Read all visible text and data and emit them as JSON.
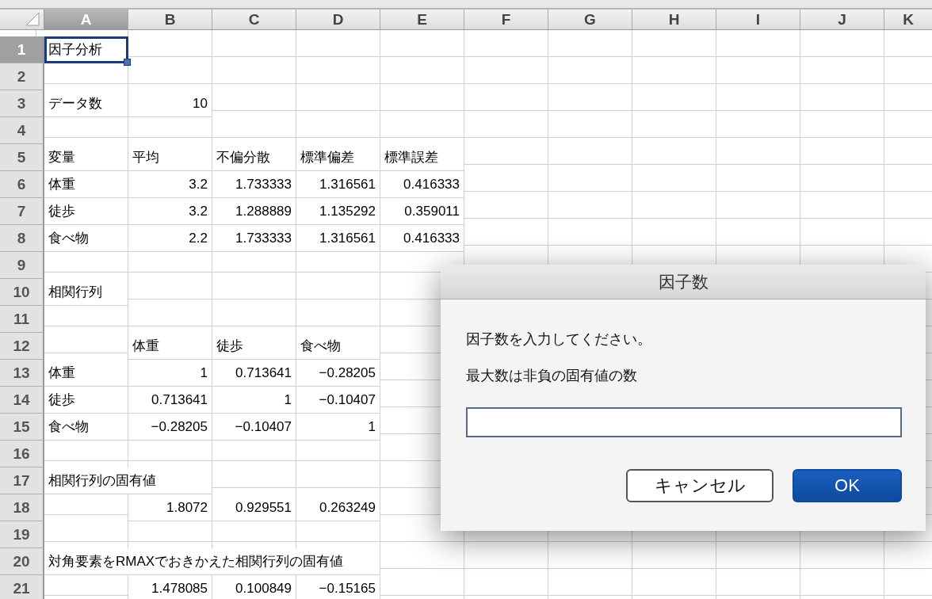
{
  "columns": [
    {
      "label": "A",
      "selected": true
    },
    {
      "label": "B",
      "selected": false
    },
    {
      "label": "C",
      "selected": false
    },
    {
      "label": "D",
      "selected": false
    },
    {
      "label": "E",
      "selected": false
    },
    {
      "label": "F",
      "selected": false
    },
    {
      "label": "G",
      "selected": false
    },
    {
      "label": "H",
      "selected": false
    },
    {
      "label": "I",
      "selected": false
    },
    {
      "label": "J",
      "selected": false
    },
    {
      "label": "K",
      "selected": false
    }
  ],
  "rows": [
    {
      "header": "1",
      "selected": true,
      "cells": [
        {
          "text": "因子分析",
          "kind": "text",
          "selected": true
        }
      ]
    },
    {
      "header": "2",
      "selected": false,
      "cells": []
    },
    {
      "header": "3",
      "selected": false,
      "cells": [
        {
          "text": "データ数",
          "kind": "text",
          "selected": false
        },
        {
          "text": "10",
          "kind": "number",
          "selected": false
        }
      ]
    },
    {
      "header": "4",
      "selected": false,
      "cells": []
    },
    {
      "header": "5",
      "selected": false,
      "cells": [
        {
          "text": "変量",
          "kind": "text",
          "selected": false
        },
        {
          "text": "平均",
          "kind": "text",
          "selected": false
        },
        {
          "text": "不偏分散",
          "kind": "text",
          "selected": false
        },
        {
          "text": "標準偏差",
          "kind": "text",
          "selected": false
        },
        {
          "text": "標準誤差",
          "kind": "text",
          "selected": false
        }
      ]
    },
    {
      "header": "6",
      "selected": false,
      "cells": [
        {
          "text": "体重",
          "kind": "text",
          "selected": false
        },
        {
          "text": "3.2",
          "kind": "number",
          "selected": false
        },
        {
          "text": "1.733333",
          "kind": "number",
          "selected": false
        },
        {
          "text": "1.316561",
          "kind": "number",
          "selected": false
        },
        {
          "text": "0.416333",
          "kind": "number",
          "selected": false
        }
      ]
    },
    {
      "header": "7",
      "selected": false,
      "cells": [
        {
          "text": "徒歩",
          "kind": "text",
          "selected": false
        },
        {
          "text": "3.2",
          "kind": "number",
          "selected": false
        },
        {
          "text": "1.288889",
          "kind": "number",
          "selected": false
        },
        {
          "text": "1.135292",
          "kind": "number",
          "selected": false
        },
        {
          "text": "0.359011",
          "kind": "number",
          "selected": false
        }
      ]
    },
    {
      "header": "8",
      "selected": false,
      "cells": [
        {
          "text": "食べ物",
          "kind": "text",
          "selected": false
        },
        {
          "text": "2.2",
          "kind": "number",
          "selected": false
        },
        {
          "text": "1.733333",
          "kind": "number",
          "selected": false
        },
        {
          "text": "1.316561",
          "kind": "number",
          "selected": false
        },
        {
          "text": "0.416333",
          "kind": "number",
          "selected": false
        }
      ]
    },
    {
      "header": "9",
      "selected": false,
      "cells": []
    },
    {
      "header": "10",
      "selected": false,
      "cells": [
        {
          "text": "相関行列",
          "kind": "text",
          "selected": false
        }
      ]
    },
    {
      "header": "11",
      "selected": false,
      "cells": []
    },
    {
      "header": "12",
      "selected": false,
      "cells": [
        null,
        {
          "text": "体重",
          "kind": "text",
          "selected": false
        },
        {
          "text": "徒歩",
          "kind": "text",
          "selected": false
        },
        {
          "text": "食べ物",
          "kind": "text",
          "selected": false
        }
      ]
    },
    {
      "header": "13",
      "selected": false,
      "cells": [
        {
          "text": "体重",
          "kind": "text",
          "selected": false
        },
        {
          "text": "1",
          "kind": "number",
          "selected": false
        },
        {
          "text": "0.713641",
          "kind": "number",
          "selected": false
        },
        {
          "text": "−0.28205",
          "kind": "number",
          "selected": false
        }
      ]
    },
    {
      "header": "14",
      "selected": false,
      "cells": [
        {
          "text": "徒歩",
          "kind": "text",
          "selected": false
        },
        {
          "text": "0.713641",
          "kind": "number",
          "selected": false
        },
        {
          "text": "1",
          "kind": "number",
          "selected": false
        },
        {
          "text": "−0.10407",
          "kind": "number",
          "selected": false
        }
      ]
    },
    {
      "header": "15",
      "selected": false,
      "cells": [
        {
          "text": "食べ物",
          "kind": "text",
          "selected": false
        },
        {
          "text": "−0.28205",
          "kind": "number",
          "selected": false
        },
        {
          "text": "−0.10407",
          "kind": "number",
          "selected": false
        },
        {
          "text": "1",
          "kind": "number",
          "selected": false
        }
      ]
    },
    {
      "header": "16",
      "selected": false,
      "cells": []
    },
    {
      "header": "17",
      "selected": false,
      "cells": [
        {
          "text": "相関行列の固有値",
          "kind": "text",
          "selected": false
        }
      ]
    },
    {
      "header": "18",
      "selected": false,
      "cells": [
        null,
        {
          "text": "1.8072",
          "kind": "number",
          "selected": false
        },
        {
          "text": "0.929551",
          "kind": "number",
          "selected": false
        },
        {
          "text": "0.263249",
          "kind": "number",
          "selected": false
        }
      ]
    },
    {
      "header": "19",
      "selected": false,
      "cells": []
    },
    {
      "header": "20",
      "selected": false,
      "cells": [
        {
          "text": "対角要素をRMAXでおきかえた相関行列の固有値",
          "kind": "text",
          "selected": false
        }
      ]
    },
    {
      "header": "21",
      "selected": false,
      "cells": [
        null,
        {
          "text": "1.478085",
          "kind": "number",
          "selected": false
        },
        {
          "text": "0.100849",
          "kind": "number",
          "selected": false
        },
        {
          "text": "−0.15165",
          "kind": "number",
          "selected": false
        }
      ]
    }
  ],
  "dialog": {
    "title": "因子数",
    "messages": [
      "因子数を入力してください。",
      "最大数は非負の固有値の数"
    ],
    "buttons": [
      {
        "label": "キャンセル",
        "kind": "normal"
      },
      {
        "label": "OK",
        "kind": "default"
      }
    ]
  }
}
